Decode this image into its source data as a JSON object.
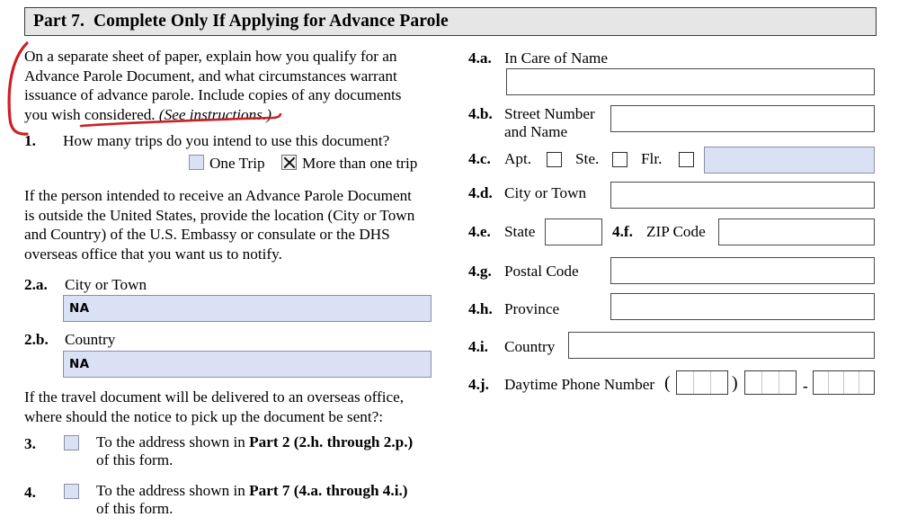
{
  "header": {
    "title": "Part 7.  Complete Only If Applying for Advance Parole"
  },
  "left_column": {
    "intro_paragraph": "On a separate sheet of paper, explain how you qualify for an\nAdvance Parole Document, and what circumstances warrant\nissuance of advance parole. Include copies of any documents\nyou wish considered. ",
    "intro_italic": "(See instructions.)",
    "item1": {
      "number": "1.",
      "question": "How many trips do you intend to use this document?",
      "option_one_label": "One Trip",
      "option_one_checked": false,
      "option_many_label": "More than one trip",
      "option_many_checked": true
    },
    "overseas_paragraph": "If the person intended to receive an Advance Parole Document\nis outside the United States, provide the location (City or Town\nand Country) of the U.S. Embassy or consulate or the DHS\noverseas office that you want us to notify.",
    "item2a": {
      "number": "2.a.",
      "label": "City or Town",
      "value": "NA"
    },
    "item2b": {
      "number": "2.b.",
      "label": "Country",
      "value": "NA"
    },
    "delivery_paragraph": "If the travel document will be delivered to an overseas office,\nwhere should the notice to pick up the document be sent?:",
    "item3": {
      "number": "3.",
      "text_before": "To the address shown in ",
      "text_bold": "Part 2 (2.h. through 2.p.)",
      "text_after": "of this form.",
      "checked": false
    },
    "item4": {
      "number": "4.",
      "text_before": "To the address shown in ",
      "text_bold": "Part 7 (4.a. through 4.i.)",
      "text_after": "of this form.",
      "checked": false
    }
  },
  "right_column": {
    "item4a": {
      "number": "4.a.",
      "label": "In Care of Name",
      "value": ""
    },
    "item4b": {
      "number": "4.b.",
      "label": "Street Number\nand Name",
      "value": ""
    },
    "item4c": {
      "number": "4.c.",
      "apt_label": "Apt.",
      "ste_label": "Ste.",
      "flr_label": "Flr.",
      "apt_checked": false,
      "ste_checked": false,
      "flr_checked": false,
      "value": ""
    },
    "item4d": {
      "number": "4.d.",
      "label": "City or Town",
      "value": ""
    },
    "item4e": {
      "number": "4.e.",
      "label": "State",
      "value": ""
    },
    "item4f": {
      "number": "4.f.",
      "label": "ZIP Code",
      "value": ""
    },
    "item4g": {
      "number": "4.g.",
      "label": "Postal Code",
      "value": ""
    },
    "item4h": {
      "number": "4.h.",
      "label": "Province",
      "value": ""
    },
    "item4i": {
      "number": "4.i.",
      "label": "Country",
      "value": ""
    },
    "item4j": {
      "number": "4.j.",
      "label": "Daytime Phone Number",
      "open_paren": "(",
      "close_paren": ")",
      "dash": "-",
      "area_cells": 3,
      "prefix_cells": 3,
      "line_cells": 4
    }
  },
  "annotations": {
    "bracket_color": "#cc2026",
    "underline_color": "#cc2026"
  },
  "colors": {
    "header_bg": "#e6e6e6",
    "filled_field_bg": "#dbe1f5",
    "filled_field_border": "#8b8fa3",
    "box_border": "#4a4a4a"
  }
}
